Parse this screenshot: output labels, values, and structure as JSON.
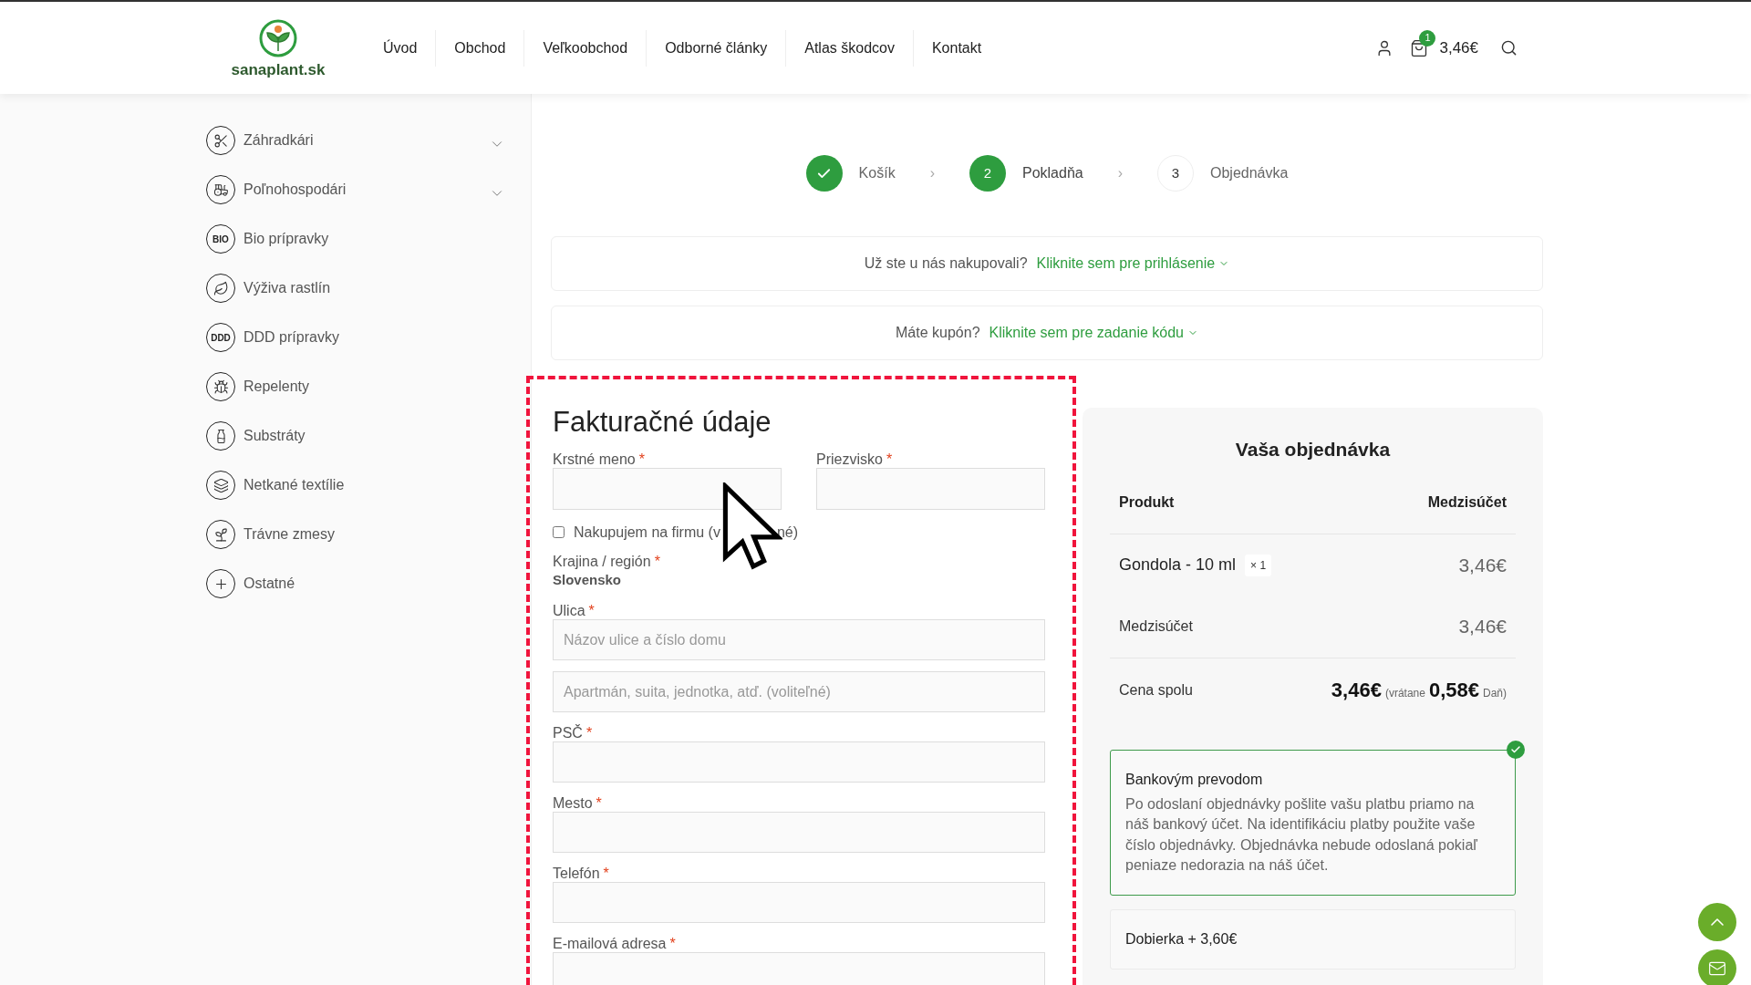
{
  "header": {
    "logo_text": "sanaplant.sk",
    "nav": [
      {
        "label": "Úvod"
      },
      {
        "label": "Obchod"
      },
      {
        "label": "Veľkoobchod"
      },
      {
        "label": "Odborné články"
      },
      {
        "label": "Atlas škodcov"
      },
      {
        "label": "Kontakt"
      }
    ],
    "cart_count": "1",
    "cart_total": "3,46€"
  },
  "sidebar": {
    "items": [
      {
        "label": "Záhradkári",
        "expandable": true
      },
      {
        "label": "Poľnohospodári",
        "expandable": true
      },
      {
        "label": "Bio prípravky",
        "expandable": false,
        "badge_text": "BIO"
      },
      {
        "label": "Výživa rastlín",
        "expandable": false
      },
      {
        "label": "DDD prípravky",
        "expandable": false,
        "badge_text": "DDD"
      },
      {
        "label": "Repelenty",
        "expandable": false
      },
      {
        "label": "Substráty",
        "expandable": false
      },
      {
        "label": "Netkané textílie",
        "expandable": false
      },
      {
        "label": "Trávne zmesy",
        "expandable": false
      },
      {
        "label": "Ostatné",
        "expandable": false
      }
    ]
  },
  "steps": [
    {
      "label": "Košík",
      "done": true,
      "selected": false
    },
    {
      "number": "2",
      "label": "Pokladňa",
      "done": false,
      "selected": true
    },
    {
      "number": "3",
      "label": "Objednávka",
      "done": false,
      "selected": false
    }
  ],
  "step_separator": "›",
  "notices": [
    {
      "text": "Už ste u nás nakupovali?",
      "link": "Kliknite sem pre prihlásenie"
    },
    {
      "text": "Máte kupón?",
      "link": "Kliknite sem pre zadanie kódu"
    }
  ],
  "billing": {
    "title": "Fakturačné údaje",
    "required_mark": "*",
    "name_fields": [
      {
        "label": "Krstné meno",
        "required": true
      },
      {
        "label": "Priezvisko",
        "required": true
      }
    ],
    "company_checkbox": {
      "label_start": "Nakupujem na firmu (v",
      "label_end": "né)",
      "checked": false
    },
    "country": {
      "label": "Krajina / región",
      "required": true,
      "value": "Slovensko"
    },
    "fields": [
      {
        "label": "Ulica",
        "required": true,
        "placeholder": "Názov ulice a číslo domu"
      },
      {
        "placeholder": "Apartmán, suita, jednotka, atď. (voliteľné)"
      },
      {
        "label": "PSČ",
        "required": true
      },
      {
        "label": "Mesto",
        "required": true
      },
      {
        "label": "Telefón",
        "required": true
      },
      {
        "label": "E-mailová adresa",
        "required": true
      }
    ]
  },
  "order": {
    "title": "Vaša objednávka",
    "columns": [
      "Produkt",
      "Medzisúčet"
    ],
    "items": [
      {
        "name": "Gondola - 10 ml",
        "quantity": "× 1",
        "price": "3,46€"
      }
    ],
    "subtotal": {
      "label": "Medzisúčet",
      "value": "3,46€"
    },
    "total": {
      "label": "Cena spolu",
      "value": "3,46€",
      "tax_prefix": "(vrátane",
      "tax": "0,58€",
      "tax_suffix": "Daň)"
    }
  },
  "payment_methods": [
    {
      "title": "Bankovým prevodom",
      "description": "Po odoslaní objednávky pošlite vašu platbu priamo na náš bankový účet. Na identifikáciu platby použite vaše číslo objednávky. Objednávka nebude odoslaná pokiaľ peniaze nedorazia na náš účet.",
      "selected": true
    },
    {
      "title": "Dobierka + 3,60€",
      "selected": false
    }
  ]
}
